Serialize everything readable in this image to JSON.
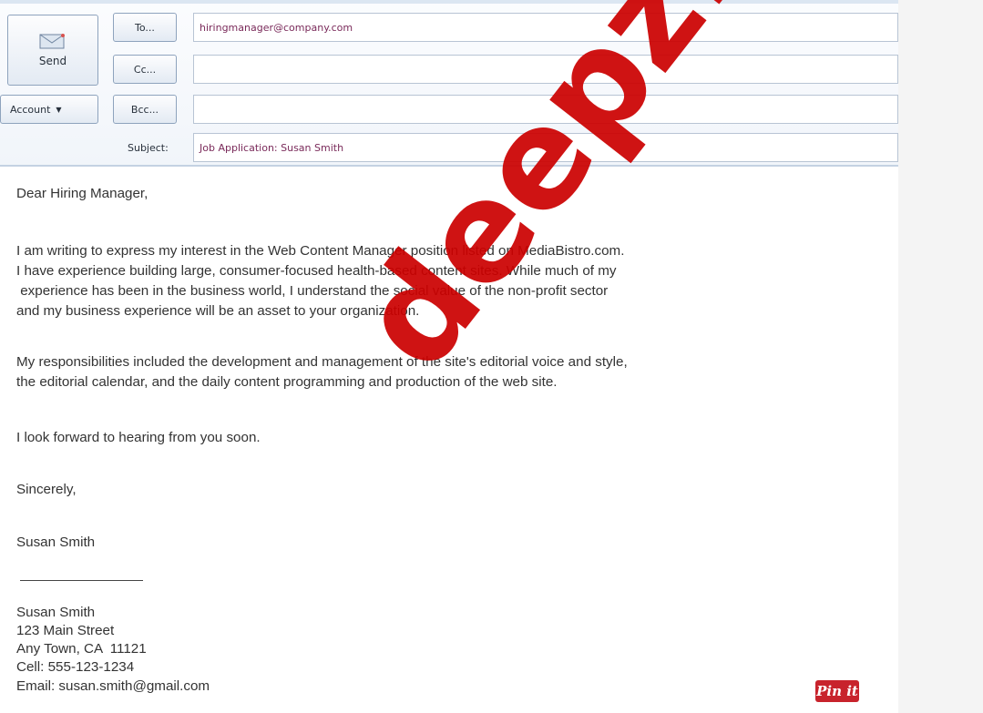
{
  "compose": {
    "send_label": "Send",
    "account_label": "Account",
    "to_label": "To...",
    "cc_label": "Cc...",
    "bcc_label": "Bcc...",
    "subject_label": "Subject:",
    "to_value": "hiringmanager@company.com",
    "cc_value": "",
    "bcc_value": "",
    "subject_value": "Job Application: Susan Smith"
  },
  "letter": {
    "greeting": "Dear Hiring Manager,",
    "paragraph1": [
      "I am writing to express my interest in the Web Content Manager position listed on MediaBistro.com.",
      "I have experience building large, consumer-focused health-based content sites. While much of my",
      " experience has been in the business world, I understand the social value of the non-profit sector",
      "and my business experience will be an asset to your organization."
    ],
    "paragraph2": [
      "My responsibilities included the development and management of the site's editorial voice and style,",
      "the editorial calendar, and the daily content programming and production of the web site."
    ],
    "paragraph3": "I look forward to hearing from you soon.",
    "closing": "Sincerely,",
    "signature_name": "Susan Smith",
    "contact": {
      "name": "Susan Smith",
      "street": "123 Main Street",
      "city": "Any Town, CA  11121",
      "cell": "Cell: 555-123-1234",
      "email": "Email: susan.smith@gmail.com"
    }
  },
  "overlay": {
    "watermark": "deepz.n",
    "pin_label": "Pin it"
  },
  "colors": {
    "header_bg": "#f1f5fa",
    "field_text": "#7a2a5a",
    "watermark": "#cc0000",
    "pin_bg": "#c8232c"
  },
  "icons": {
    "send": "envelope-icon",
    "account": "caret-down-icon"
  }
}
